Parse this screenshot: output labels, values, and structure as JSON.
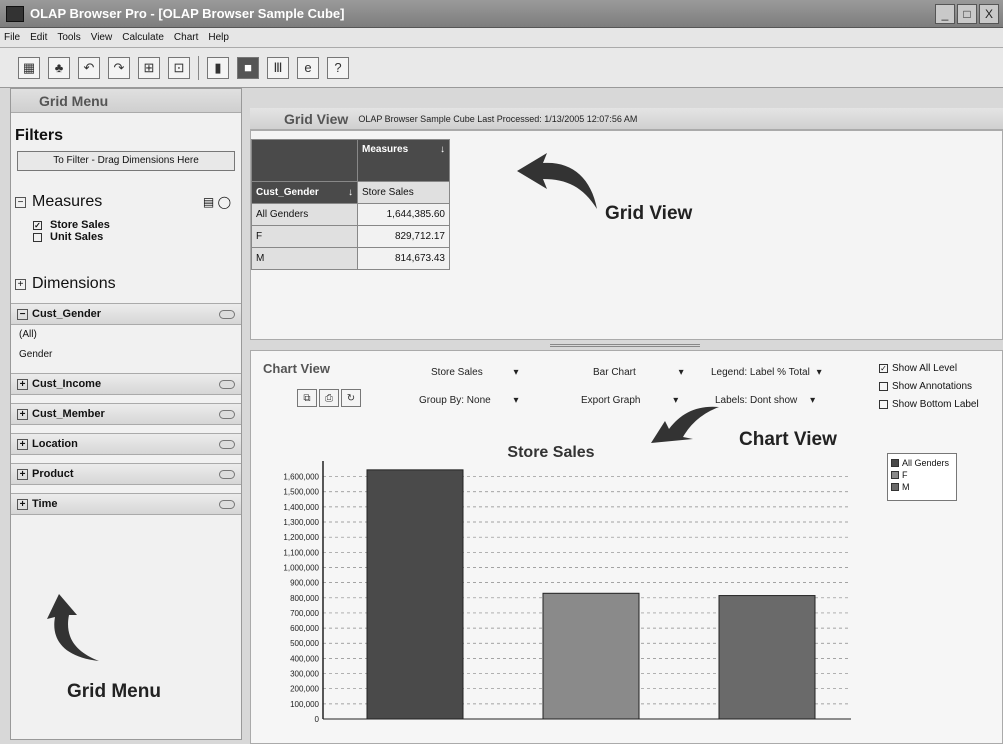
{
  "window": {
    "title": "OLAP Browser Pro - [OLAP Browser Sample Cube]",
    "buttons": [
      "_",
      "□",
      "X"
    ]
  },
  "menu": [
    "File",
    "Edit",
    "Tools",
    "View",
    "Calculate",
    "Chart",
    "Help"
  ],
  "toolbar": [
    "grid-icon",
    "tree-icon",
    "undo-icon",
    "redo-icon",
    "expand-icon",
    "counter-icon",
    "bar-chart-icon",
    "square-icon",
    "columns-icon",
    "e-icon",
    "help-icon"
  ],
  "sidebar": {
    "header": "Grid Menu",
    "filters_title": "Filters",
    "filter_drop": "To Filter - Drag Dimensions Here",
    "measures_title": "Measures",
    "measures": [
      {
        "label": "Store Sales",
        "checked": true
      },
      {
        "label": "Unit Sales",
        "checked": false
      }
    ],
    "dimensions_title": "Dimensions",
    "dimensions": [
      {
        "label": "Cust_Gender",
        "expanded": true,
        "children": [
          "(All)",
          "Gender"
        ]
      },
      {
        "label": "Cust_Income",
        "expanded": false
      },
      {
        "label": "Cust_Member",
        "expanded": false
      },
      {
        "label": "Location",
        "expanded": false
      },
      {
        "label": "Product",
        "expanded": false
      },
      {
        "label": "Time",
        "expanded": false
      }
    ],
    "annotation": "Grid Menu"
  },
  "grid_view": {
    "title": "Grid View",
    "info": "OLAP Browser Sample Cube  Last Processed: 1/13/2005 12:07:56 AM",
    "measures_header": "Measures",
    "row_header": "Cust_Gender",
    "column_header": "Store Sales",
    "rows": [
      {
        "label": "All Genders",
        "value": "1,644,385.60"
      },
      {
        "label": "F",
        "value": "829,712.17"
      },
      {
        "label": "M",
        "value": "814,673.43"
      }
    ],
    "annotation": "Grid View"
  },
  "chart_view": {
    "title": "Chart View",
    "controls": {
      "measure": "Store Sales",
      "chart_type": "Bar Chart",
      "legend": "Legend: Label % Total",
      "group_by": "Group By: None",
      "export": "Export Graph",
      "labels": "Labels: Dont show"
    },
    "options": [
      {
        "label": "Show All Level",
        "checked": true
      },
      {
        "label": "Show Annotations",
        "checked": false
      },
      {
        "label": "Show Bottom Label",
        "checked": false
      }
    ],
    "annotation": "Chart View"
  },
  "chart_data": {
    "type": "bar",
    "title": "Store Sales",
    "categories": [
      "All Genders",
      "F",
      "M"
    ],
    "values": [
      1644385.6,
      829712.17,
      814673.43
    ],
    "colors": [
      "#4a4a4a",
      "#8a8a8a",
      "#6a6a6a"
    ],
    "yticks": [
      "0",
      "100,000",
      "200,000",
      "300,000",
      "400,000",
      "500,000",
      "600,000",
      "700,000",
      "800,000",
      "900,000",
      "1,000,000",
      "1,100,000",
      "1,200,000",
      "1,300,000",
      "1,400,000",
      "1,500,000",
      "1,600,000"
    ],
    "ylim": [
      0,
      1650000
    ],
    "legend": [
      "All Genders",
      "F",
      "M"
    ],
    "grid": true
  }
}
